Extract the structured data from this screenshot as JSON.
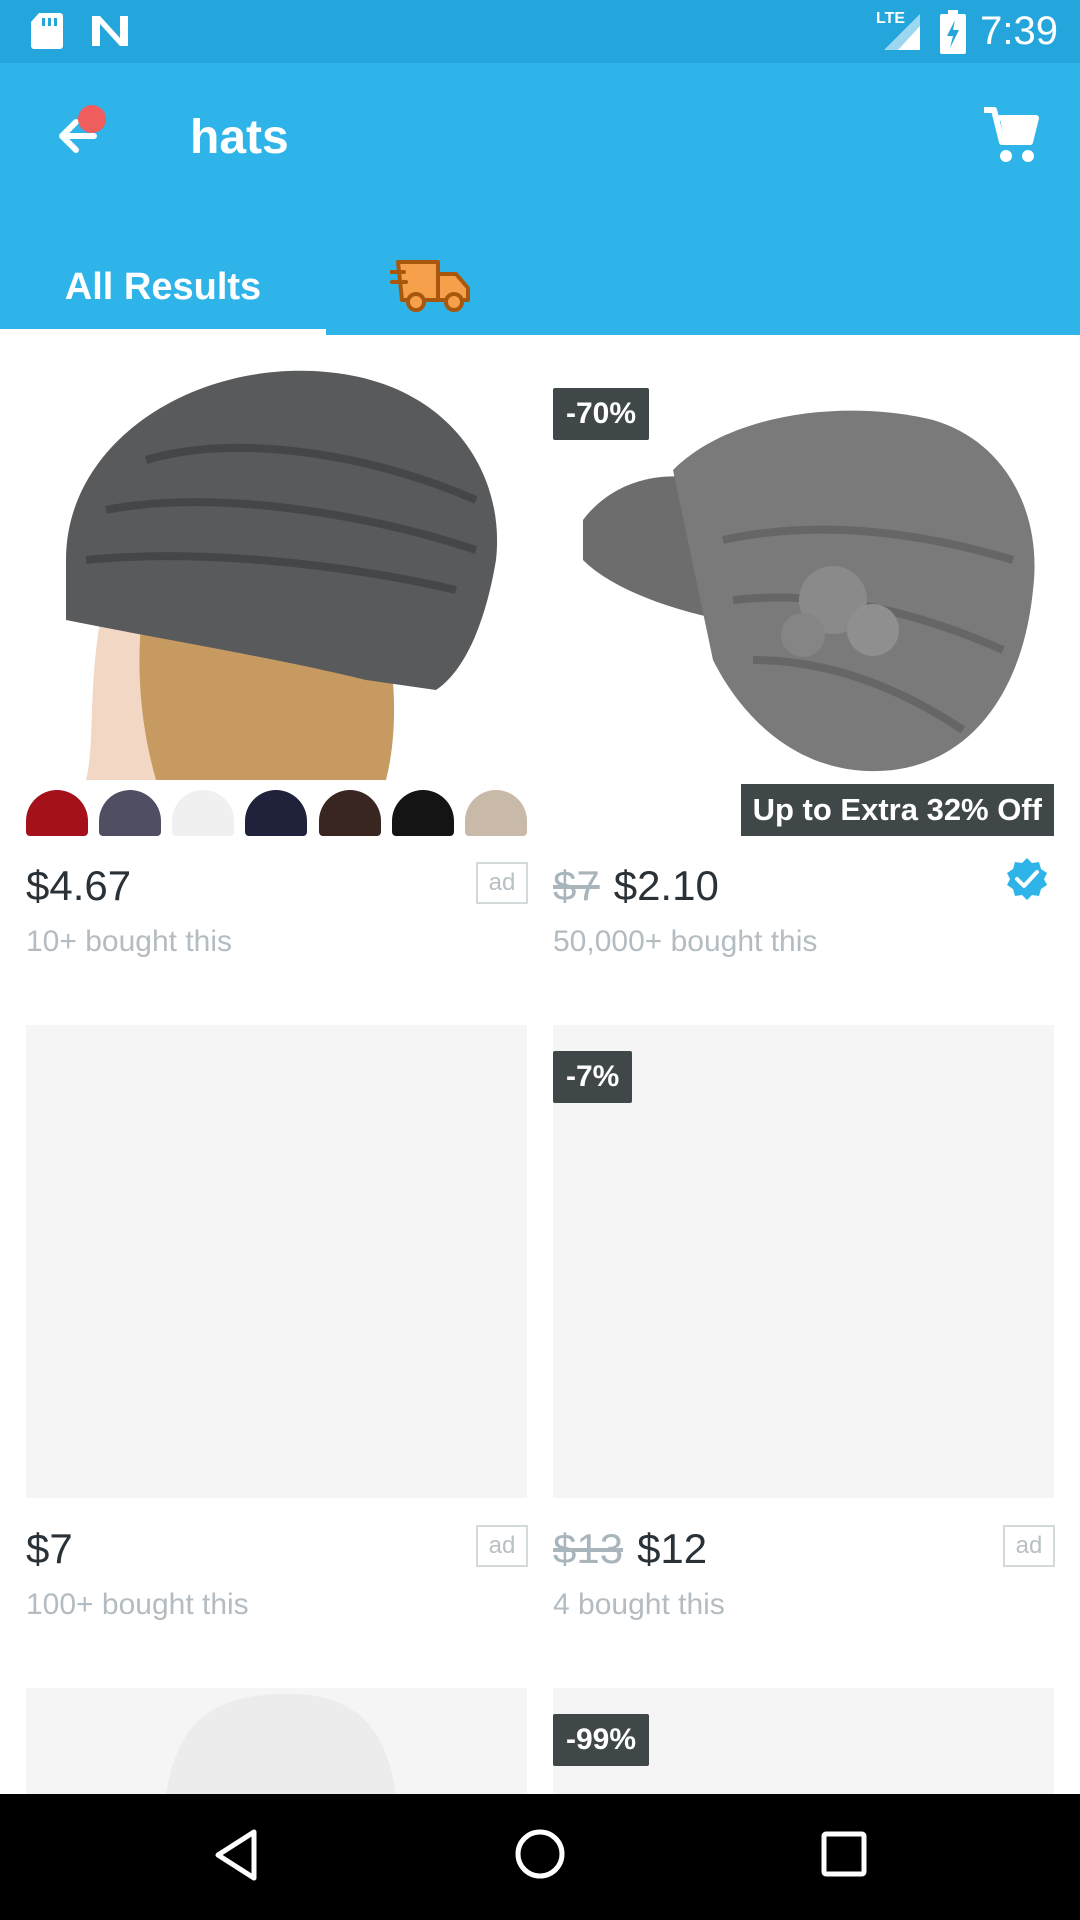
{
  "status_bar": {
    "time": "7:39",
    "network": "LTE",
    "icons": [
      "sd-card-icon",
      "n-logo-icon",
      "signal-icon",
      "battery-charging-icon"
    ]
  },
  "header": {
    "title": "hats",
    "back_icon": "back-arrow-icon",
    "cart_icon": "shopping-cart-icon"
  },
  "tabs": [
    {
      "label": "All Results",
      "selected": true
    },
    {
      "label": "",
      "icon": "delivery-truck-icon",
      "selected": false
    }
  ],
  "products": [
    {
      "price": "$4.67",
      "old_price": "",
      "bought": "10+ bought this",
      "ad": "ad",
      "discount": "",
      "swatch_colors": [
        "#a5111b",
        "#4f4e63",
        "#f0f0f0",
        "#20213a",
        "#3a2620",
        "#141414",
        "#c8b9a8"
      ]
    },
    {
      "price": "$2.10",
      "old_price": "$7",
      "bought": "50,000+ bought this",
      "discount": "-70%",
      "extra_badge": "Up to Extra 32% Off",
      "verified_icon": "verified-check-icon"
    },
    {
      "price": "$7",
      "old_price": "",
      "bought": "100+ bought this",
      "ad": "ad",
      "discount": ""
    },
    {
      "price": "$12",
      "old_price": "$13",
      "bought": "4 bought this",
      "ad": "ad",
      "discount": "-7%"
    },
    {
      "discount": ""
    },
    {
      "discount": "-99%"
    }
  ],
  "nav_bar": {
    "icons": [
      "nav-back-icon",
      "nav-home-icon",
      "nav-recents-icon"
    ]
  },
  "colors": {
    "status_bar": "#24a6dc",
    "app_bar": "#2fb4e9",
    "badge": "#404749",
    "verified": "#2fb4e9"
  }
}
